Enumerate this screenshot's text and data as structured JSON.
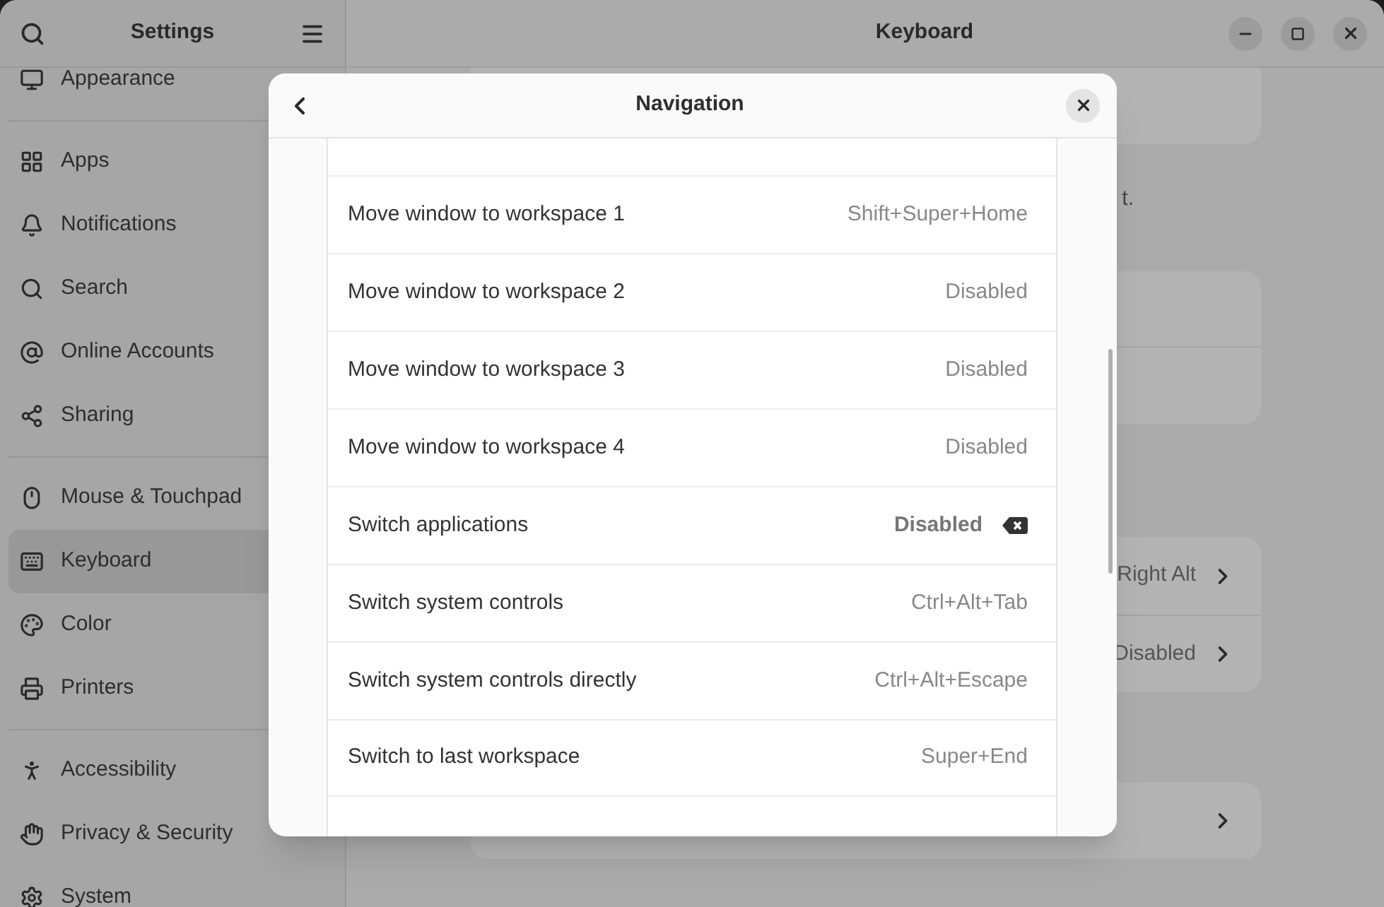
{
  "sidebar": {
    "title": "Settings",
    "sections": [
      {
        "items": [
          {
            "label": "Appearance",
            "selected": false
          }
        ]
      },
      {
        "items": [
          {
            "label": "Apps",
            "selected": false
          },
          {
            "label": "Notifications",
            "selected": false
          },
          {
            "label": "Search",
            "selected": false
          },
          {
            "label": "Online Accounts",
            "selected": false
          },
          {
            "label": "Sharing",
            "selected": false
          }
        ]
      },
      {
        "items": [
          {
            "label": "Mouse & Touchpad",
            "selected": false
          },
          {
            "label": "Keyboard",
            "selected": true
          },
          {
            "label": "Color",
            "selected": false
          },
          {
            "label": "Printers",
            "selected": false
          }
        ]
      },
      {
        "items": [
          {
            "label": "Accessibility",
            "selected": false
          },
          {
            "label": "Privacy & Security",
            "selected": false
          },
          {
            "label": "System",
            "selected": false
          }
        ]
      }
    ]
  },
  "main": {
    "title": "Keyboard",
    "note": "t.",
    "input_rows": [
      {
        "value": "Right Alt"
      },
      {
        "value": "Disabled"
      }
    ]
  },
  "dialog": {
    "title": "Navigation",
    "rows": [
      {
        "action": "Move window to workspace 1",
        "shortcut": "Shift+Super+Home",
        "kind": "shortcut"
      },
      {
        "action": "Move window to workspace 2",
        "shortcut": "Disabled",
        "kind": "shortcut"
      },
      {
        "action": "Move window to workspace 3",
        "shortcut": "Disabled",
        "kind": "shortcut"
      },
      {
        "action": "Move window to workspace 4",
        "shortcut": "Disabled",
        "kind": "shortcut"
      },
      {
        "action": "Switch applications",
        "shortcut": "Disabled",
        "kind": "clearable"
      },
      {
        "action": "Switch system controls",
        "shortcut": "Ctrl+Alt+Tab",
        "kind": "shortcut"
      },
      {
        "action": "Switch system controls directly",
        "shortcut": "Ctrl+Alt+Escape",
        "kind": "shortcut"
      },
      {
        "action": "Switch to last workspace",
        "shortcut": "Super+End",
        "kind": "shortcut"
      }
    ]
  }
}
